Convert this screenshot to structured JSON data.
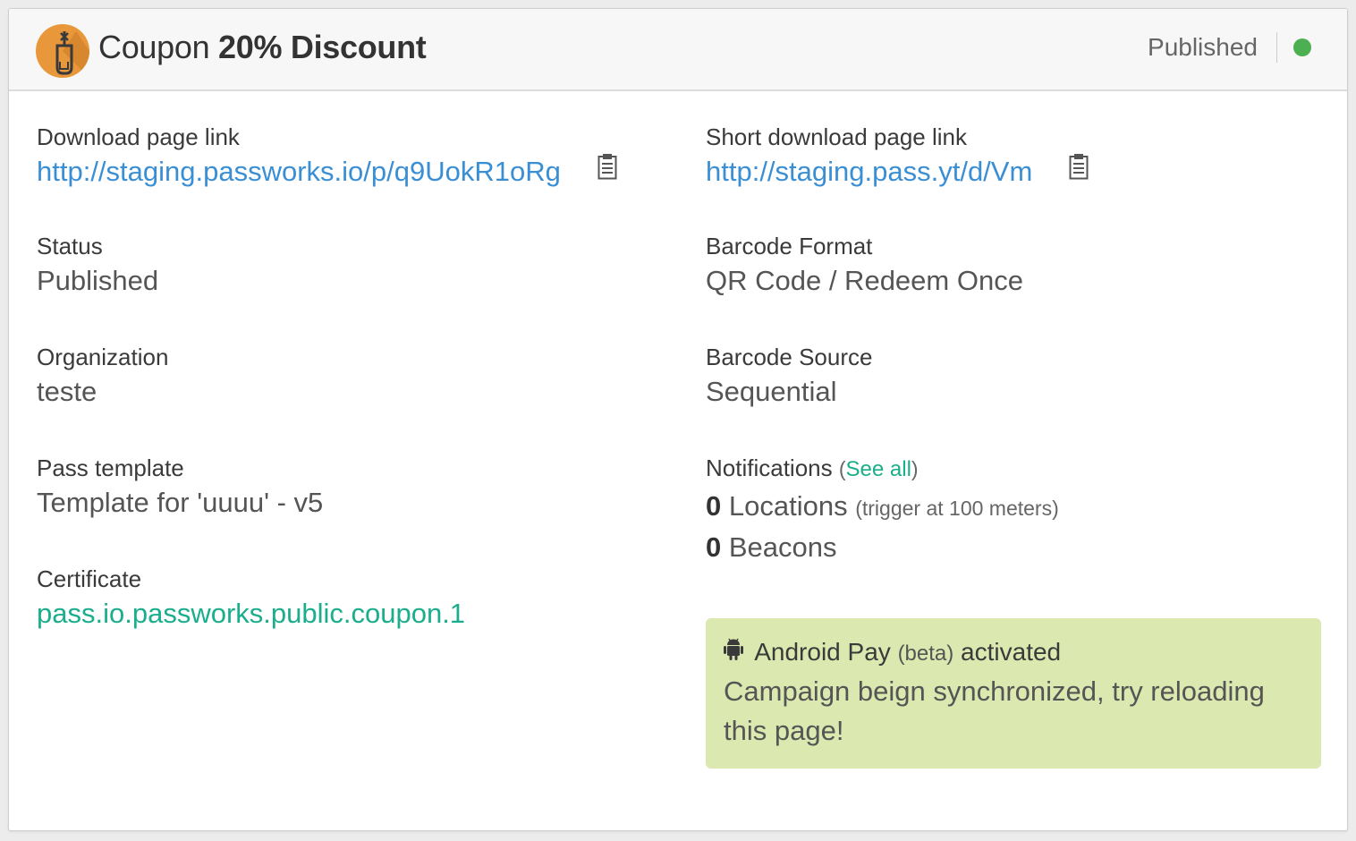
{
  "header": {
    "title_prefix": "Coupon",
    "title_bold": "20% Discount",
    "status": "Published",
    "status_color": "#4caf50",
    "logo_color": "#e8973a",
    "logo_icon": "bottle-opener-icon"
  },
  "left": {
    "download_link": {
      "label": "Download page link",
      "value": "http://staging.passworks.io/p/q9UokR1oRg",
      "icon": "clipboard-icon"
    },
    "status": {
      "label": "Status",
      "value": "Published"
    },
    "organization": {
      "label": "Organization",
      "value": "teste"
    },
    "pass_template": {
      "label": "Pass template",
      "value": "Template for 'uuuu' - v5"
    },
    "certificate": {
      "label": "Certificate",
      "value": "pass.io.passworks.public.coupon.1"
    }
  },
  "right": {
    "short_link": {
      "label": "Short download page link",
      "value": "http://staging.pass.yt/d/Vm",
      "icon": "clipboard-icon"
    },
    "barcode_format": {
      "label": "Barcode Format",
      "value": "QR Code / Redeem Once"
    },
    "barcode_source": {
      "label": "Barcode Source",
      "value": "Sequential"
    },
    "notifications": {
      "label": "Notifications",
      "open_paren": "(",
      "see_all": "See all",
      "close_paren": ")",
      "locations_count": "0",
      "locations_label": "Locations",
      "locations_note": "(trigger at 100 meters)",
      "beacons_count": "0",
      "beacons_label": "Beacons"
    },
    "android_pay": {
      "icon": "android-icon",
      "name": "Android Pay",
      "beta": "(beta)",
      "state": "activated",
      "message": "Campaign beign synchronized, try reloading this page!",
      "background": "#dbe8b0"
    }
  },
  "colors": {
    "link_blue": "#3a8fd4",
    "link_green": "#1aae8c"
  }
}
